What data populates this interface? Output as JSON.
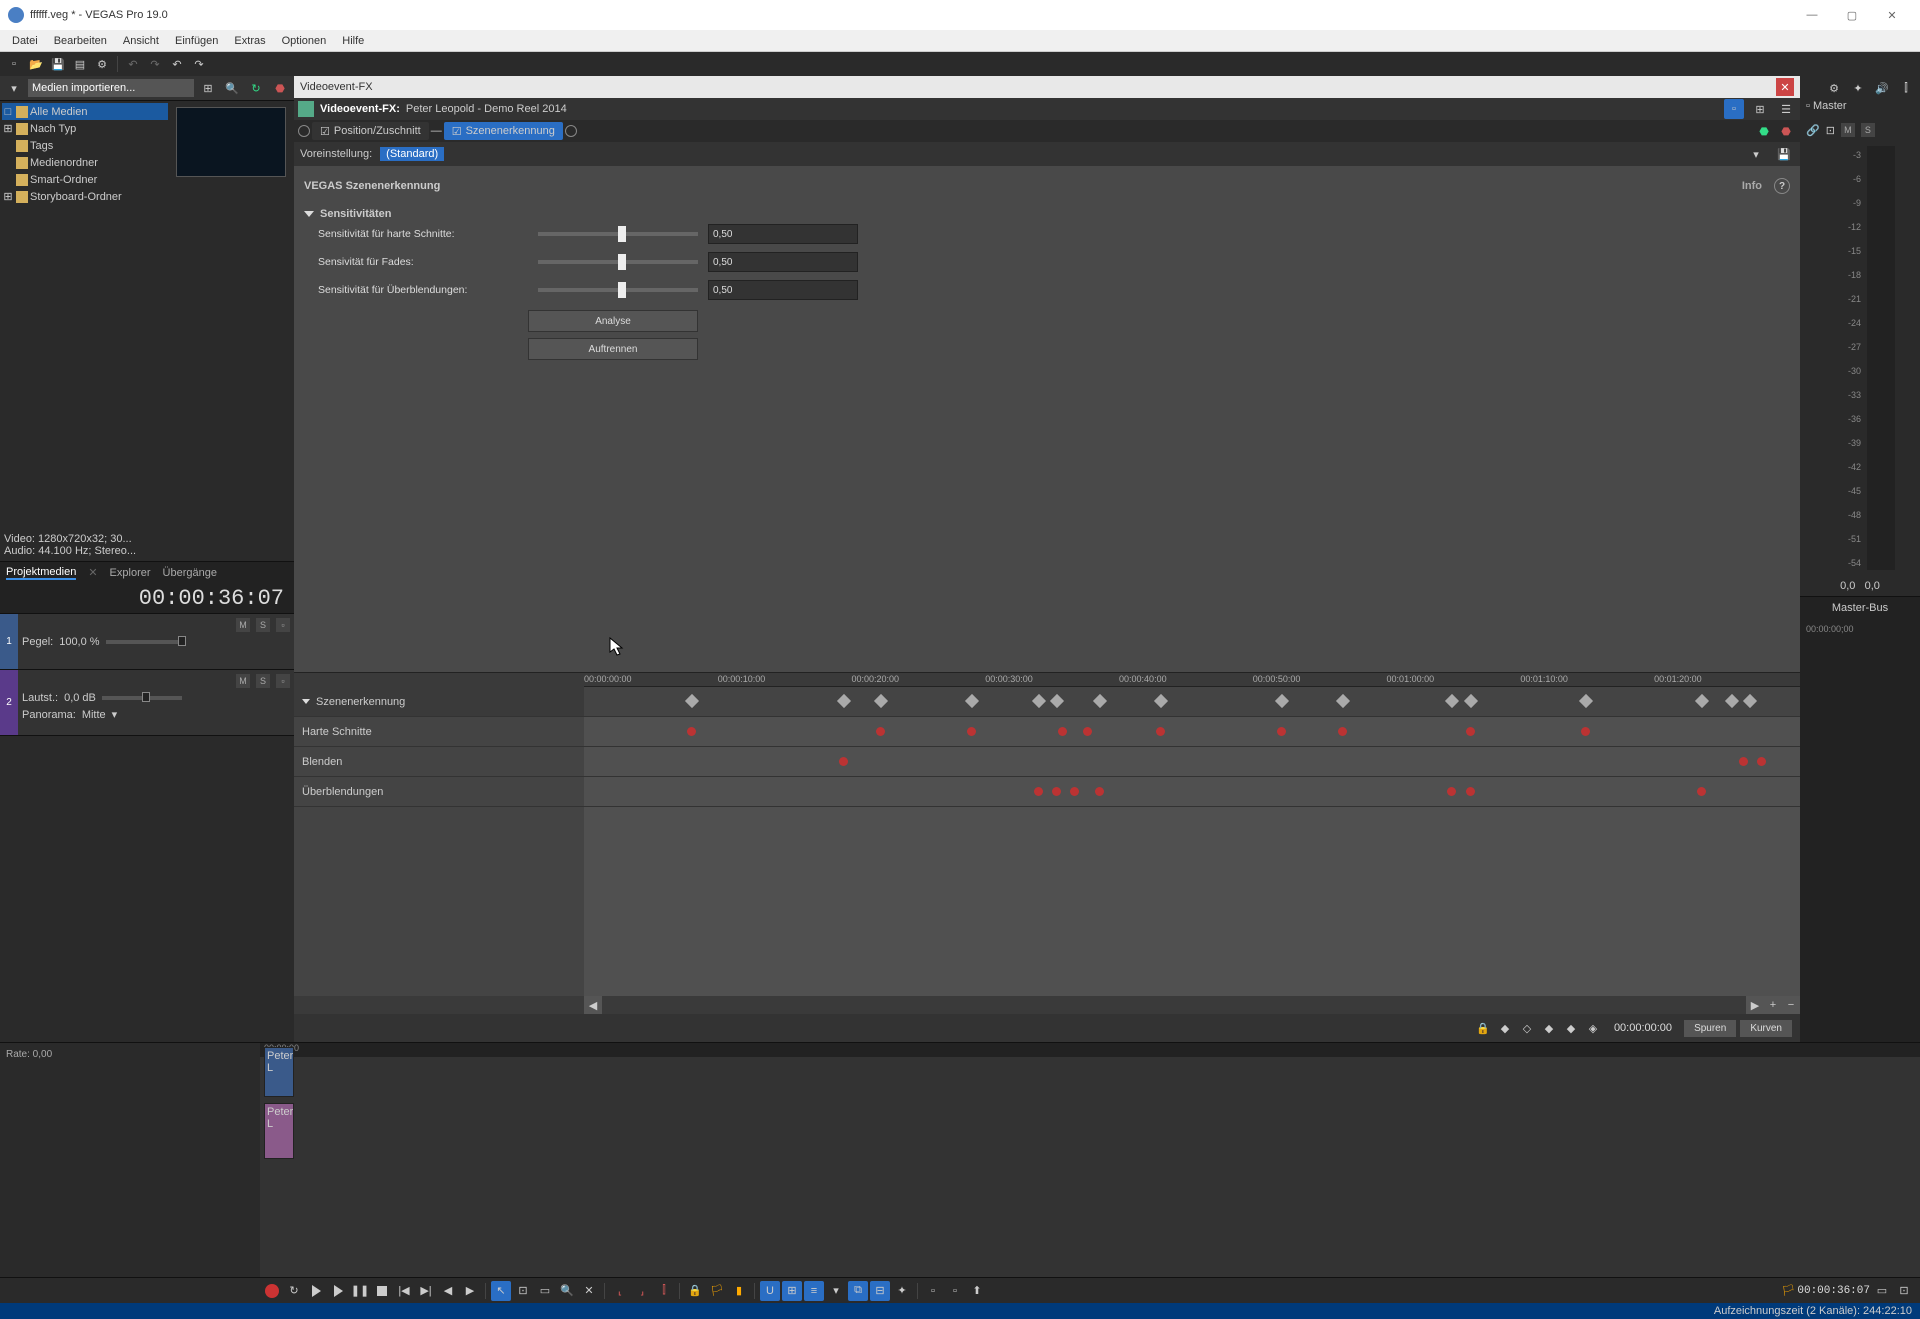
{
  "title": "ffffff.veg * - VEGAS Pro 19.0",
  "menu": [
    "Datei",
    "Bearbeiten",
    "Ansicht",
    "Einfügen",
    "Extras",
    "Optionen",
    "Hilfe"
  ],
  "import_label": "Medien importieren...",
  "tree": {
    "items": [
      "Alle Medien",
      "Nach Typ",
      "Tags",
      "Medienordner",
      "Smart-Ordner",
      "Storyboard-Ordner"
    ],
    "selected": 0
  },
  "media_meta": {
    "video": "Video: 1280x720x32; 30...",
    "audio": "Audio: 44.100 Hz; Stereo..."
  },
  "tabs": [
    "Projektmedien",
    "Explorer",
    "Übergänge"
  ],
  "tabs_active": 0,
  "timecode": "00:00:36:07",
  "tracks": [
    {
      "num": "1",
      "type": "video",
      "label": "Pegel:",
      "value": "100,0 %",
      "m": "M",
      "s": "S"
    },
    {
      "num": "2",
      "type": "audio",
      "label": "Lautst.:",
      "value": "0,0 dB",
      "pan_label": "Panorama:",
      "pan_value": "Mitte",
      "m": "M",
      "s": "S"
    }
  ],
  "fx_window_title": "Videoevent-FX",
  "fx_header": {
    "prefix": "Videoevent-FX:",
    "clip": "Peter Leopold - Demo Reel 2014"
  },
  "chain": [
    {
      "label": "Position/Zuschnitt",
      "active": false
    },
    {
      "label": "Szenenerkennung",
      "active": true
    }
  ],
  "preset_label": "Voreinstellung:",
  "preset_value": "(Standard)",
  "plugin_title": "VEGAS Szenenerkennung",
  "info_label": "Info",
  "section": "Sensitivitäten",
  "params": [
    {
      "label": "Sensitivität für harte Schnitte:",
      "value": "0,50"
    },
    {
      "label": "Sensivität für Fades:",
      "value": "0,50"
    },
    {
      "label": "Sensitivität für Überblendungen:",
      "value": "0,50"
    }
  ],
  "btn_analyse": "Analyse",
  "btn_split": "Auftrennen",
  "scene_rows": [
    "Szenenerkennung",
    "Harte Schnitte",
    "Blenden",
    "Überblendungen"
  ],
  "ruler_ticks": [
    "00:00:00:00",
    "00:00:10:00",
    "00:00:20:00",
    "00:00:30:00",
    "00:00:40:00",
    "00:00:50:00",
    "00:01:00:00",
    "00:01:10:00",
    "00:01:20:00"
  ],
  "diamonds": [
    8.5,
    21,
    24,
    31.5,
    37,
    38.5,
    42,
    47,
    57,
    62,
    71,
    72.5,
    82,
    91.5,
    94,
    95.5
  ],
  "dots_hard": [
    8.5,
    24,
    31.5,
    39,
    41,
    47,
    57,
    62,
    72.5,
    82
  ],
  "dots_blend": [
    21,
    95,
    96.5
  ],
  "dots_uber": [
    37,
    38.5,
    40,
    42,
    71,
    72.5,
    91.5
  ],
  "st_buttons": {
    "spuren": "Spuren",
    "kurven": "Kurven",
    "tc": "00:00:00:00"
  },
  "master": {
    "label": "Master",
    "m": "M",
    "s": "S",
    "bus": "Master-Bus"
  },
  "meter_scale": [
    -3,
    -6,
    -9,
    -12,
    -15,
    -18,
    -21,
    -24,
    -27,
    -30,
    -33,
    -36,
    -39,
    -42,
    -45,
    -48,
    -51,
    -54
  ],
  "meter_peak": "0,0",
  "transport_tc": "00:00:36:07",
  "rate": "Rate: 0,00",
  "status": "Aufzeichnungszeit (2 Kanäle): 244:22:10",
  "clip_name": "Peter L",
  "ruler_small": "00:00:00"
}
